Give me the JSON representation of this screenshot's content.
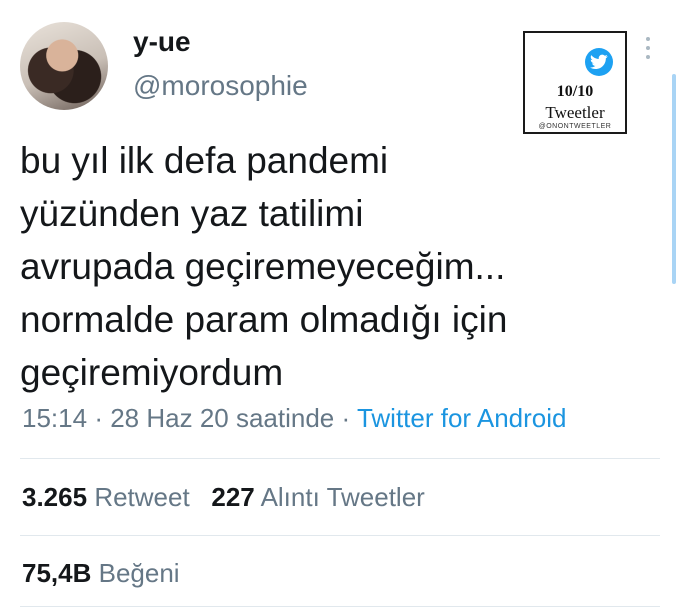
{
  "author": {
    "display_name": "y-ue",
    "handle": "@morosophie"
  },
  "badge": {
    "icon": "twitter-bird-icon",
    "score": "10/10",
    "label": "Tweetler",
    "account": "@ONONTWEETLER"
  },
  "tweet": {
    "lines": [
      "bu yıl ilk defa pandemi",
      "yüzünden yaz tatilimi",
      "avrupada geçiremeyeceğim...",
      "normalde param olmadığı için",
      "geçiremiyordum"
    ],
    "time": "15:14",
    "date": "28 Haz 20 saatinde",
    "separator": "·",
    "source": "Twitter for Android"
  },
  "stats": {
    "retweets_count": "3.265",
    "retweets_label": "Retweet",
    "quotes_count": "227",
    "quotes_label": "Alıntı Tweetler",
    "likes_count": "75,4B",
    "likes_label": "Beğeni"
  },
  "colors": {
    "accent": "#1da1f2",
    "link": "#1b95e0",
    "secondary_text": "#657786"
  }
}
